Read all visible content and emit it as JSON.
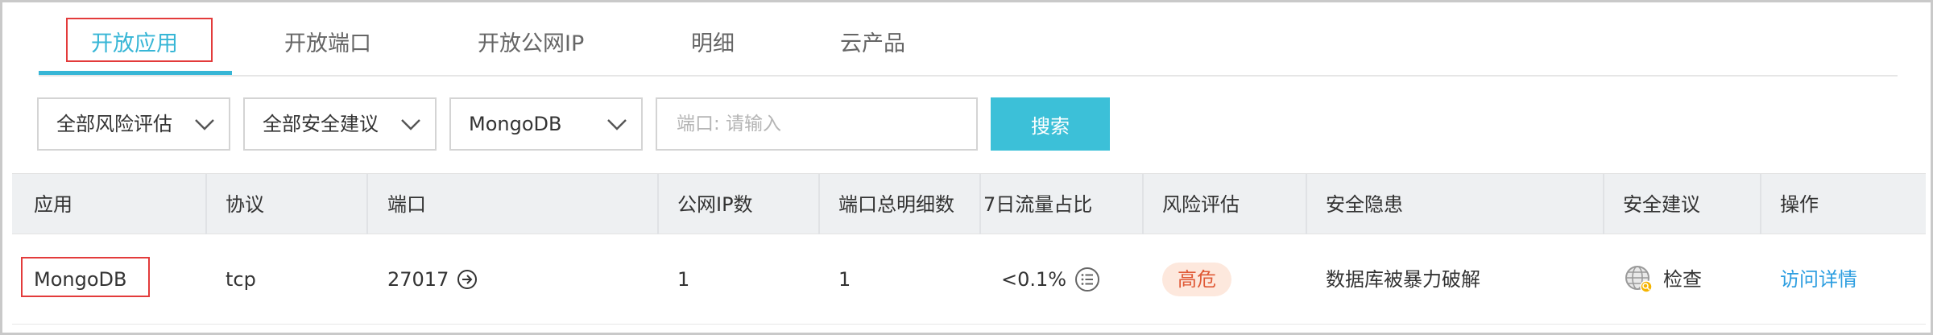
{
  "tabs": [
    {
      "label": "开放应用",
      "active": true
    },
    {
      "label": "开放端口",
      "active": false
    },
    {
      "label": "开放公网IP",
      "active": false
    },
    {
      "label": "明细",
      "active": false
    },
    {
      "label": "云产品",
      "active": false
    }
  ],
  "filters": {
    "risk_eval": "全部风险评估",
    "security_advice": "全部安全建议",
    "app_type": "MongoDB",
    "port_placeholder": "端口: 请输入",
    "search_label": "搜索"
  },
  "table": {
    "columns": [
      "应用",
      "协议",
      "端口",
      "公网IP数",
      "端口总明细数",
      "7日流量占比",
      "风险评估",
      "安全隐患",
      "安全建议",
      "操作"
    ],
    "rows": [
      {
        "app": "MongoDB",
        "protocol": "tcp",
        "port": "27017",
        "public_ip_count": "1",
        "port_detail_count": "1",
        "traffic_ratio": "<0.1%",
        "risk": "高危",
        "hazard": "数据库被暴力破解",
        "advice": "检查",
        "action": "访问详情"
      }
    ]
  },
  "colors": {
    "accent": "#37b6d6",
    "button": "#3cc0d8",
    "risk_high_bg": "#fde8dd",
    "risk_high_text": "#e05a37",
    "link": "#2d9ee0",
    "highlight_box": "#e33b3b"
  }
}
